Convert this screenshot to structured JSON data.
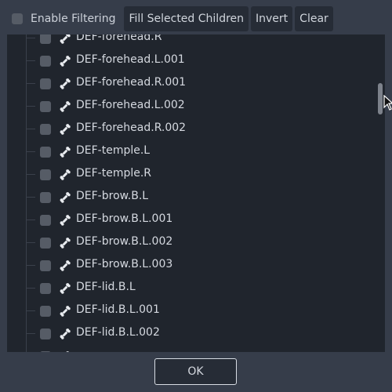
{
  "toolbar": {
    "enable_filtering_label": "Enable Filtering",
    "fill_selected_children_label": "Fill Selected Children",
    "invert_label": "Invert",
    "clear_label": "Clear"
  },
  "tree": {
    "icon": "bone-icon",
    "items": [
      {
        "label": "DEF-forehead.R",
        "checked": false
      },
      {
        "label": "DEF-forehead.L.001",
        "checked": false
      },
      {
        "label": "DEF-forehead.R.001",
        "checked": false
      },
      {
        "label": "DEF-forehead.L.002",
        "checked": false
      },
      {
        "label": "DEF-forehead.R.002",
        "checked": false
      },
      {
        "label": "DEF-temple.L",
        "checked": false
      },
      {
        "label": "DEF-temple.R",
        "checked": false
      },
      {
        "label": "DEF-brow.B.L",
        "checked": false
      },
      {
        "label": "DEF-brow.B.L.001",
        "checked": false
      },
      {
        "label": "DEF-brow.B.L.002",
        "checked": false
      },
      {
        "label": "DEF-brow.B.L.003",
        "checked": false
      },
      {
        "label": "DEF-lid.B.L",
        "checked": false
      },
      {
        "label": "DEF-lid.B.L.001",
        "checked": false
      },
      {
        "label": "DEF-lid.B.L.002",
        "checked": false
      },
      {
        "label": "",
        "checked": false
      }
    ]
  },
  "footer": {
    "ok_label": "OK"
  }
}
